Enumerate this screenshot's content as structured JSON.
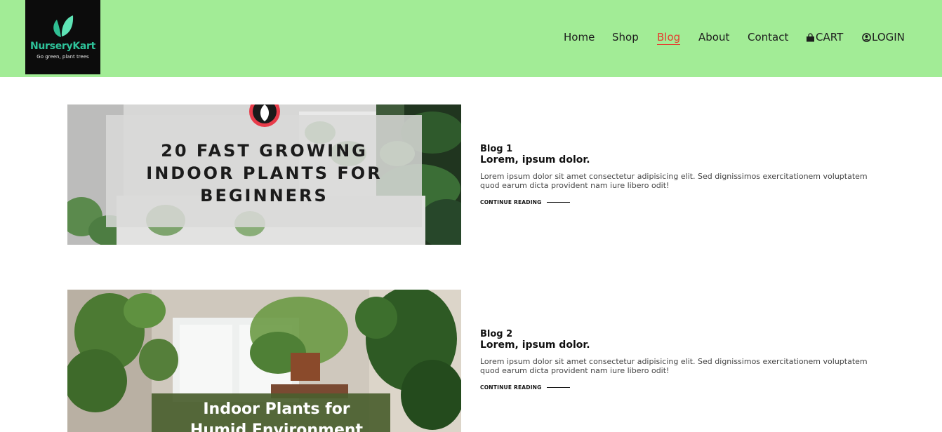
{
  "brand": {
    "name": "NurseryKart",
    "tagline": "Go green, plant trees",
    "logo_icon": "leaf-icon"
  },
  "nav": {
    "items": [
      {
        "label": "Home",
        "active": false
      },
      {
        "label": "Shop",
        "active": false
      },
      {
        "label": "Blog",
        "active": true
      },
      {
        "label": "About",
        "active": false
      },
      {
        "label": "Contact",
        "active": false
      },
      {
        "label": "CART",
        "icon": "shopping-bag-icon",
        "active": false
      },
      {
        "label": "LOGIN",
        "icon": "user-circle-icon",
        "active": false
      }
    ],
    "active_color": "#e63b2e",
    "background": "#a2ec96"
  },
  "posts": [
    {
      "number": "Blog 1",
      "title": "Lorem, ipsum dolor.",
      "excerpt": "Lorem ipsum dolor sit amet consectetur adipisicing elit. Sed dignissimos exercitationem voluptatem quod earum dicta provident nam iure libero odit!",
      "link_label": "CONTINUE READING",
      "image_text": [
        "20 FAST GROWING",
        "INDOOR PLANTS FOR",
        "BEGINNERS"
      ]
    },
    {
      "number": "Blog 2",
      "title": "Lorem, ipsum dolor.",
      "excerpt": "Lorem ipsum dolor sit amet consectetur adipisicing elit. Sed dignissimos exercitationem voluptatem quod earum dicta provident nam iure libero odit!",
      "link_label": "CONTINUE READING",
      "image_text": [
        "Indoor Plants for",
        "Humid Environment"
      ]
    }
  ]
}
